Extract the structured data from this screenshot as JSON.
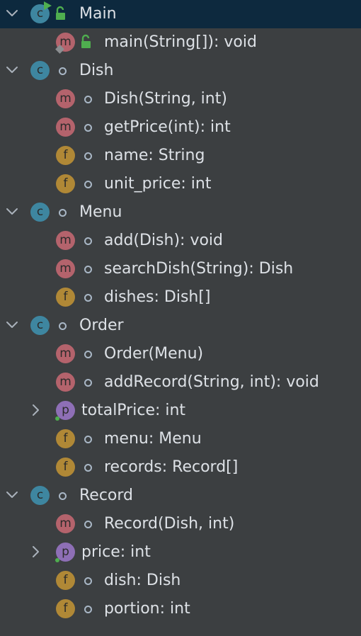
{
  "tree": [
    {
      "kind": "class",
      "label": "Main",
      "expanded": true,
      "visibility": "public",
      "runnable": true,
      "selected": true
    },
    {
      "kind": "method",
      "label": "main(String[]): void",
      "visibility": "public",
      "static": true
    },
    {
      "kind": "class",
      "label": "Dish",
      "expanded": true,
      "visibility": "package"
    },
    {
      "kind": "method",
      "label": "Dish(String, int)",
      "visibility": "package"
    },
    {
      "kind": "method",
      "label": "getPrice(int): int",
      "visibility": "package"
    },
    {
      "kind": "field",
      "label": "name: String",
      "visibility": "package"
    },
    {
      "kind": "field",
      "label": "unit_price: int",
      "visibility": "package"
    },
    {
      "kind": "class",
      "label": "Menu",
      "expanded": true,
      "visibility": "package"
    },
    {
      "kind": "method",
      "label": "add(Dish): void",
      "visibility": "package"
    },
    {
      "kind": "method",
      "label": "searchDish(String): Dish",
      "visibility": "package"
    },
    {
      "kind": "field",
      "label": "dishes: Dish[]",
      "visibility": "package"
    },
    {
      "kind": "class",
      "label": "Order",
      "expanded": true,
      "visibility": "package"
    },
    {
      "kind": "method",
      "label": "Order(Menu)",
      "visibility": "package"
    },
    {
      "kind": "method",
      "label": "addRecord(String, int): void",
      "visibility": "package"
    },
    {
      "kind": "property",
      "label": "totalPrice: int",
      "expanded": false
    },
    {
      "kind": "field",
      "label": "menu: Menu",
      "visibility": "package"
    },
    {
      "kind": "field",
      "label": "records: Record[]",
      "visibility": "package"
    },
    {
      "kind": "class",
      "label": "Record",
      "expanded": true,
      "visibility": "package"
    },
    {
      "kind": "method",
      "label": "Record(Dish, int)",
      "visibility": "package"
    },
    {
      "kind": "property",
      "label": "price: int",
      "expanded": false
    },
    {
      "kind": "field",
      "label": "dish: Dish",
      "visibility": "package"
    },
    {
      "kind": "field",
      "label": "portion: int",
      "visibility": "package"
    }
  ],
  "badge_letters": {
    "class": "c",
    "method": "m",
    "field": "f",
    "property": "p"
  },
  "icons": {
    "chevron_expanded": "chevron-down-icon",
    "chevron_collapsed": "chevron-right-icon",
    "public": "lock-open-icon",
    "package": "package-visibility-icon",
    "runnable": "run-arrow-icon",
    "static": "static-diamond-icon"
  },
  "colors": {
    "background": "#3c3f41",
    "selected_row": "#0d293e",
    "text": "#dde1e6",
    "class_badge": "#3e86a0",
    "method_badge": "#b4636c",
    "field_badge": "#b08836",
    "property_badge": "#8e6fb6",
    "public_lock": "#4fae4f"
  }
}
